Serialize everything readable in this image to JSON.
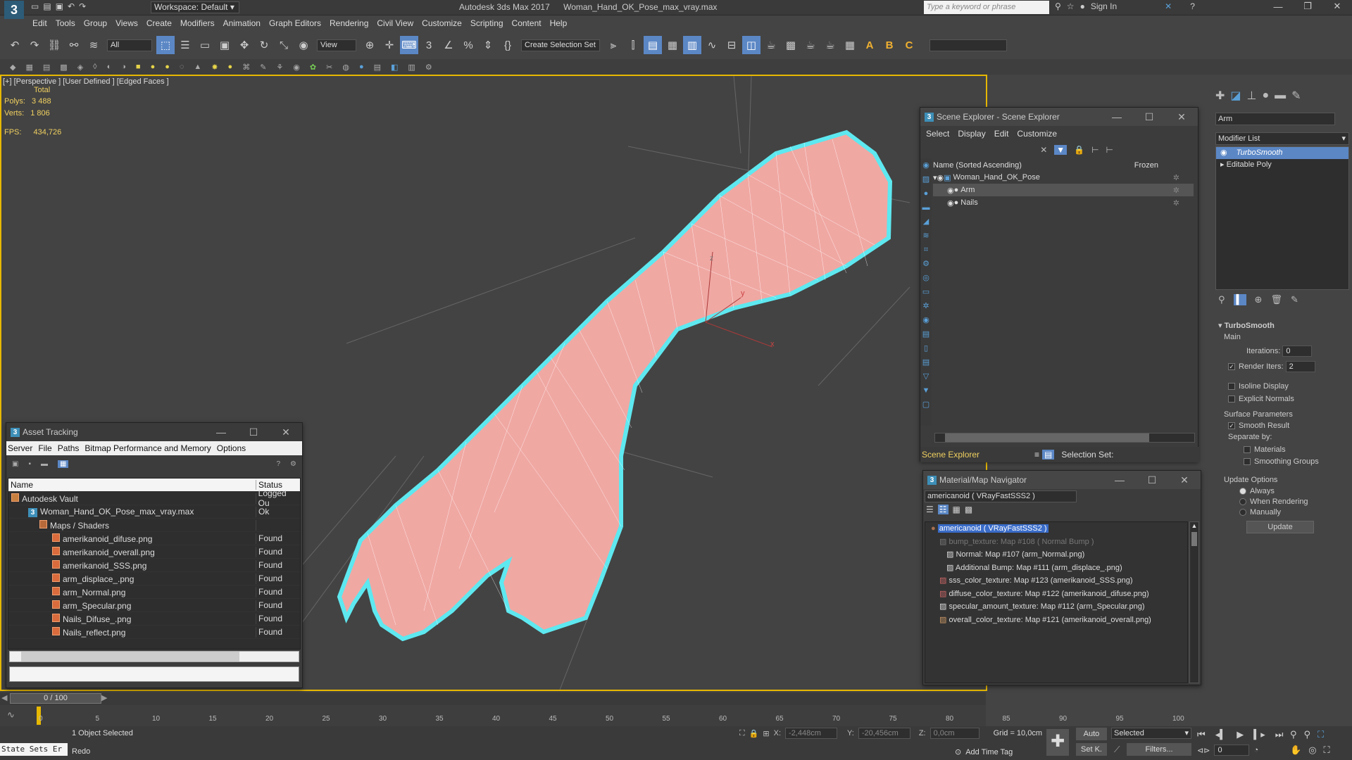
{
  "app": {
    "title": "Autodesk 3ds Max 2017",
    "file": "Woman_Hand_OK_Pose_max_vray.max",
    "workspace": "Workspace: Default",
    "search_placeholder": "Type a keyword or phrase",
    "sign_in": "Sign In"
  },
  "menu": [
    "Edit",
    "Tools",
    "Group",
    "Views",
    "Create",
    "Modifiers",
    "Animation",
    "Graph Editors",
    "Rendering",
    "Civil View",
    "Customize",
    "Scripting",
    "Content",
    "Help"
  ],
  "toolbar": {
    "filter": "All",
    "view": "View",
    "selection_set": "Create Selection Set"
  },
  "viewport": {
    "label": "[+] [Perspective ] [User Defined ] [Edged Faces ]",
    "stats_total": "Total",
    "polys_label": "Polys:",
    "polys": "3 488",
    "verts_label": "Verts:",
    "verts": "1 806",
    "fps_label": "FPS:",
    "fps": "434,726",
    "axis_y": "y",
    "axis_x": "x",
    "axis_z": "z"
  },
  "scene_explorer": {
    "title": "Scene Explorer - Scene Explorer",
    "menu": [
      "Select",
      "Display",
      "Edit",
      "Customize"
    ],
    "col_name": "Name (Sorted Ascending)",
    "col_frozen": "Frozen",
    "rows": [
      "Woman_Hand_OK_Pose",
      "Arm",
      "Nails"
    ],
    "footer_label": "Scene Explorer",
    "selection_set": "Selection Set:"
  },
  "modifier_panel": {
    "object_name": "Arm",
    "modifier_list": "Modifier List",
    "stack": [
      "TurboSmooth",
      "Editable Poly"
    ],
    "rollout_title": "TurboSmooth",
    "main": "Main",
    "iterations_label": "Iterations:",
    "iterations": "0",
    "render_iters_label": "Render Iters:",
    "render_iters": "2",
    "isoline": "Isoline Display",
    "explicit": "Explicit Normals",
    "surface_params": "Surface Parameters",
    "smooth_result": "Smooth Result",
    "separate_by": "Separate by:",
    "materials": "Materials",
    "smoothing_groups": "Smoothing Groups",
    "update_options": "Update Options",
    "always": "Always",
    "when_rendering": "When Rendering",
    "manually": "Manually",
    "update": "Update"
  },
  "asset_tracking": {
    "title": "Asset Tracking",
    "menu": [
      "Server",
      "File",
      "Paths",
      "Bitmap Performance and Memory",
      "Options"
    ],
    "col_name": "Name",
    "col_status": "Status",
    "rows": [
      {
        "name": "Autodesk Vault",
        "status": "Logged Ou"
      },
      {
        "name": "Woman_Hand_OK_Pose_max_vray.max",
        "status": "Ok"
      },
      {
        "name": "Maps / Shaders",
        "status": ""
      },
      {
        "name": "amerikanoid_difuse.png",
        "status": "Found"
      },
      {
        "name": "amerikanoid_overall.png",
        "status": "Found"
      },
      {
        "name": "amerikanoid_SSS.png",
        "status": "Found"
      },
      {
        "name": "arm_displace_.png",
        "status": "Found"
      },
      {
        "name": "arm_Normal.png",
        "status": "Found"
      },
      {
        "name": "arm_Specular.png",
        "status": "Found"
      },
      {
        "name": "Nails_Difuse_.png",
        "status": "Found"
      },
      {
        "name": "Nails_reflect.png",
        "status": "Found"
      }
    ]
  },
  "material_nav": {
    "title": "Material/Map Navigator",
    "field": "americanoid  ( VRayFastSSS2 )",
    "rows": [
      "americanoid  ( VRayFastSSS2 )",
      "bump_texture: Map #108  ( Normal Bump )",
      "Normal: Map #107 (arm_Normal.png)",
      "Additional Bump: Map #111 (arm_displace_.png)",
      "sss_color_texture: Map #123 (amerikanoid_SSS.png)",
      "diffuse_color_texture: Map #122 (amerikanoid_difuse.png)",
      "specular_amount_texture: Map #112 (arm_Specular.png)",
      "overall_color_texture: Map #121 (amerikanoid_overall.png)"
    ]
  },
  "timeline": {
    "frame": "0 / 100",
    "ticks": [
      "0",
      "5",
      "10",
      "15",
      "20",
      "25",
      "30",
      "35",
      "40",
      "45",
      "50",
      "55",
      "60",
      "65",
      "70",
      "75",
      "80",
      "85",
      "90",
      "95",
      "100"
    ]
  },
  "status": {
    "state_sets": "State Sets Er",
    "selected": "1 Object Selected",
    "prompt": "Redo",
    "x_label": "X:",
    "x": "-2,448cm",
    "y_label": "Y:",
    "y": "-20,456cm",
    "z_label": "Z:",
    "z": "0,0cm",
    "grid": "Grid = 10,0cm",
    "add_time_tag": "Add Time Tag",
    "auto": "Auto",
    "set_k": "Set K.",
    "selected_dd": "Selected",
    "filters": "Filters...",
    "frame_field": "0"
  }
}
